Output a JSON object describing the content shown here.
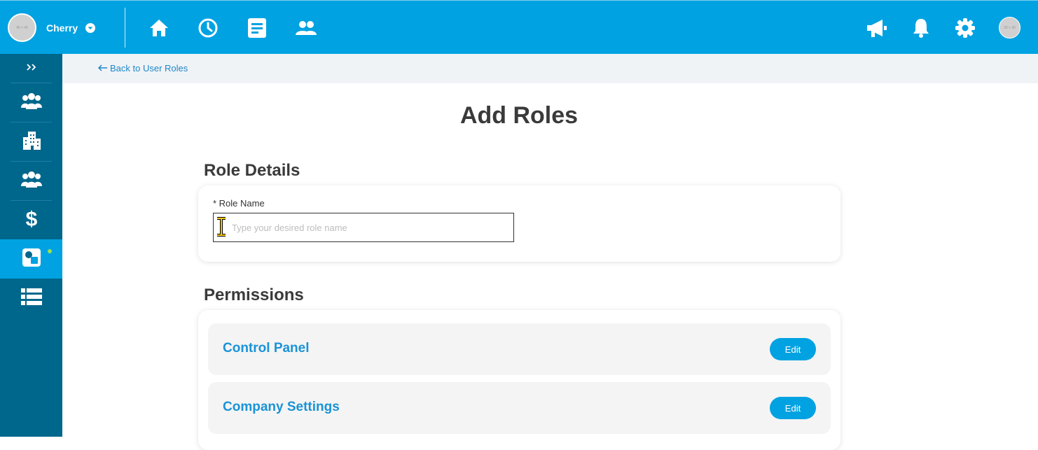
{
  "header": {
    "company_name": "Cherry",
    "avatar_text": "40 × 40",
    "user_avatar_text": "30 × 30",
    "nav_icons": [
      "home-icon",
      "clock-icon",
      "document-icon",
      "people-icon"
    ],
    "right_icons": [
      "megaphone-icon",
      "bell-icon",
      "gear-icon"
    ],
    "color": "#00a2e2"
  },
  "sidebar": {
    "expand_icon": "double-chevron-right-icon",
    "items": [
      {
        "icon": "users-icon",
        "active": false
      },
      {
        "icon": "building-icon",
        "active": false
      },
      {
        "icon": "group-icon",
        "active": false
      },
      {
        "icon": "dollar-icon",
        "active": false
      },
      {
        "icon": "roles-icon",
        "active": true
      },
      {
        "icon": "list-icon",
        "active": false
      }
    ],
    "color": "#00678c"
  },
  "breadcrumb": {
    "back_label": "Back to User Roles"
  },
  "page": {
    "title": "Add Roles"
  },
  "role_details": {
    "heading": "Role Details",
    "field_label": "* Role Name",
    "input_value": "",
    "input_placeholder": "Type your desired role name"
  },
  "permissions": {
    "heading": "Permissions",
    "rows": [
      {
        "name": "Control Panel",
        "button": "Edit"
      },
      {
        "name": "Company Settings",
        "button": "Edit"
      }
    ]
  }
}
